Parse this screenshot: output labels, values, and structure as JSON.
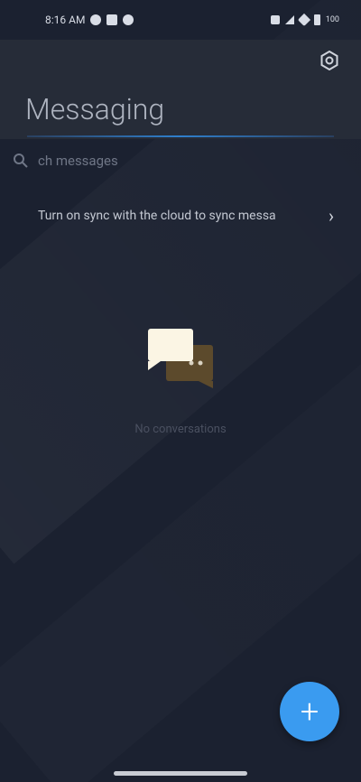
{
  "status_bar": {
    "time": "8:16 AM",
    "battery": "100"
  },
  "header": {
    "title": "Messaging",
    "settings_icon": "settings-gear-icon"
  },
  "search": {
    "placeholder": "ch messages"
  },
  "sync_banner": {
    "text": "Turn on sync with the cloud to sync messa"
  },
  "empty_state": {
    "text": "No conversations",
    "icon": "chat-bubbles-icon"
  },
  "fab": {
    "label": "+"
  },
  "colors": {
    "accent": "#3a9bf0",
    "background": "#1b2130",
    "header": "#262c38"
  }
}
